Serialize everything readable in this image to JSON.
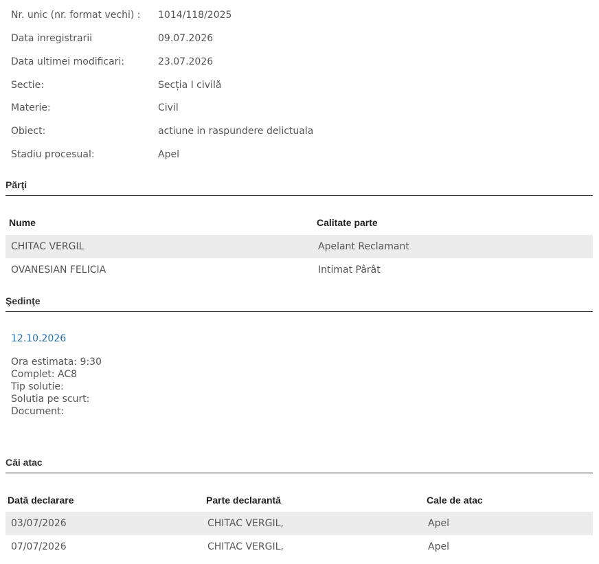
{
  "case_info": [
    {
      "label": "Nr. unic (nr. format vechi) :",
      "value": "1014/118/2025"
    },
    {
      "label": "Data inregistrarii",
      "value": "09.07.2026"
    },
    {
      "label": "Data ultimei modificari:",
      "value": "23.07.2026"
    },
    {
      "label": "Sectie:",
      "value": "Secția I civilă"
    },
    {
      "label": "Materie:",
      "value": "Civil"
    },
    {
      "label": "Obiect:",
      "value": "actiune in raspundere delictuala"
    },
    {
      "label": "Stadiu procesual:",
      "value": "Apel"
    }
  ],
  "parti": {
    "title": "Părţi",
    "headers": {
      "nume": "Nume",
      "calitate": "Calitate parte"
    },
    "rows": [
      {
        "nume": "CHITAC VERGIL",
        "calitate": "Apelant Reclamant"
      },
      {
        "nume": "OVANESIAN FELICIA",
        "calitate": "Intimat Pârât"
      }
    ]
  },
  "sedinte": {
    "title": "Şedinţe",
    "date": "12.10.2026",
    "details": [
      "Ora estimata: 9:30",
      "Complet: AC8",
      "Tip solutie:",
      "Solutia pe scurt:",
      "Document:"
    ]
  },
  "cai_atac": {
    "title": "Căi atac",
    "headers": {
      "data": "Dată declarare",
      "parte": "Parte declarantă",
      "cale": "Cale de atac"
    },
    "rows": [
      {
        "data": "03/07/2026",
        "parte": "CHITAC VERGIL,",
        "cale": "Apel"
      },
      {
        "data": "07/07/2026",
        "parte": "CHITAC VERGIL,",
        "cale": "Apel"
      }
    ]
  }
}
